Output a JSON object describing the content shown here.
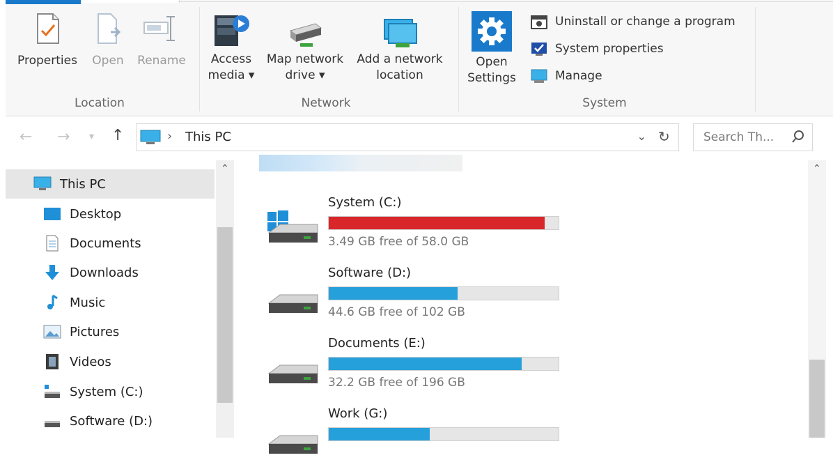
{
  "ribbon": {
    "location": {
      "group_label": "Location",
      "buttons": [
        {
          "label": "Properties",
          "enabled": true
        },
        {
          "label": "Open",
          "enabled": false
        },
        {
          "label": "Rename",
          "enabled": false
        }
      ]
    },
    "network": {
      "group_label": "Network",
      "access_media": "Access\nmedia ▾",
      "map_drive": "Map network\ndrive ▾",
      "add_location": "Add a network\nlocation"
    },
    "system": {
      "group_label": "System",
      "open_settings": "Open\nSettings",
      "items": [
        "Uninstall or change a program",
        "System properties",
        "Manage"
      ]
    }
  },
  "address": {
    "path": "This PC",
    "separator": "›",
    "search_placeholder": "Search Th..."
  },
  "nav": {
    "items": [
      {
        "label": "This PC",
        "icon": "monitor-icon",
        "selected": true
      },
      {
        "label": "Desktop",
        "icon": "desktop-icon"
      },
      {
        "label": "Documents",
        "icon": "document-icon"
      },
      {
        "label": "Downloads",
        "icon": "download-arrow-icon"
      },
      {
        "label": "Music",
        "icon": "music-note-icon"
      },
      {
        "label": "Pictures",
        "icon": "picture-icon"
      },
      {
        "label": "Videos",
        "icon": "film-icon"
      },
      {
        "label": "System (C:)",
        "icon": "system-drive-icon"
      },
      {
        "label": "Software (D:)",
        "icon": "drive-icon"
      }
    ]
  },
  "drives": [
    {
      "name": "System (C:)",
      "free": "3.49 GB free of 58.0 GB",
      "used_fraction": 0.94,
      "color": "#d9262a",
      "windows_logo": true
    },
    {
      "name": "Software (D:)",
      "free": "44.6 GB free of 102 GB",
      "used_fraction": 0.56,
      "color": "#26a0da",
      "windows_logo": false
    },
    {
      "name": "Documents (E:)",
      "free": "32.2 GB free of 196 GB",
      "used_fraction": 0.84,
      "color": "#26a0da",
      "windows_logo": false
    },
    {
      "name": "Work (G:)",
      "free": "",
      "used_fraction": 0.44,
      "color": "#26a0da",
      "windows_logo": false
    }
  ],
  "colors": {
    "accent": "#1979ca",
    "bar_ok": "#26a0da",
    "bar_full": "#d9262a"
  }
}
